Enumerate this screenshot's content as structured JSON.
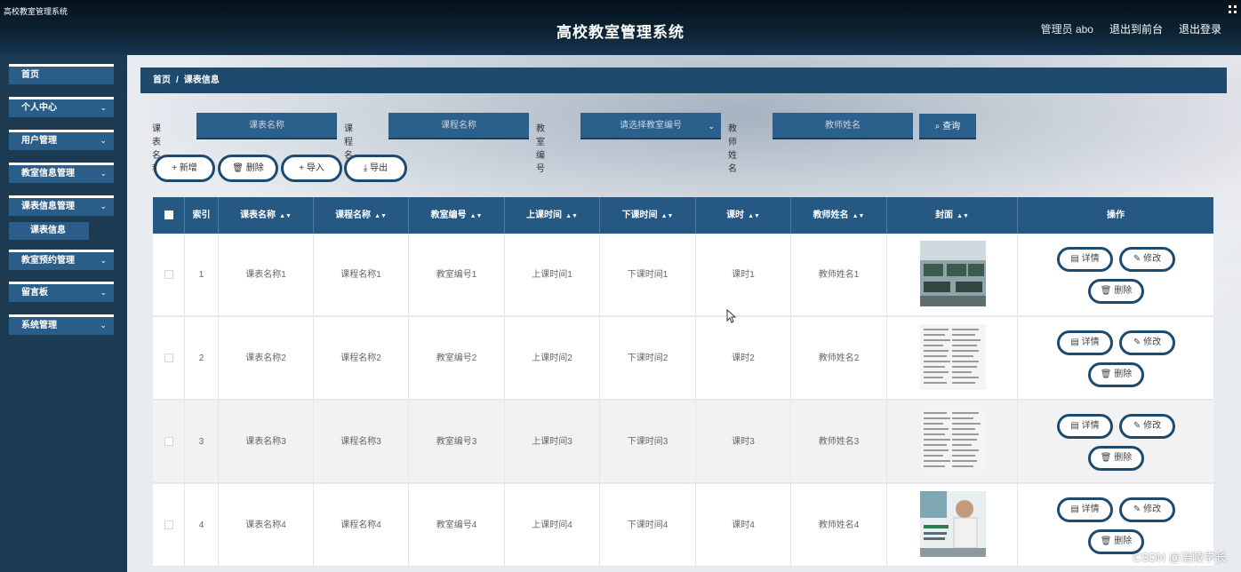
{
  "window_title": "高校教室管理系统",
  "app_title": "高校教室管理系统",
  "top_links": {
    "admin": "管理员 abo",
    "front": "退出到前台",
    "logout": "退出登录"
  },
  "sidebar": {
    "items": [
      {
        "label": "首页"
      },
      {
        "label": "个人中心"
      },
      {
        "label": "用户管理"
      },
      {
        "label": "教室信息管理"
      },
      {
        "label": "课表信息管理"
      },
      {
        "label": "教室预约管理"
      },
      {
        "label": "留言板"
      },
      {
        "label": "系统管理"
      }
    ],
    "active_sub": "课表信息"
  },
  "breadcrumb": {
    "home": "首页",
    "sep": "/",
    "current": "课表信息"
  },
  "search": {
    "f1_label": "课表名称",
    "f1_placeholder": "课表名称",
    "f2_label": "课程名称",
    "f2_placeholder": "课程名称",
    "f3_label": "教室编号",
    "f3_placeholder": "请选择教室编号",
    "f4_label": "教师姓名",
    "f4_placeholder": "教师姓名",
    "button": "查询"
  },
  "actions": {
    "add": "新增",
    "delete": "删除",
    "import": "导入",
    "export": "导出"
  },
  "table": {
    "headers": [
      "索引",
      "课表名称",
      "课程名称",
      "教室编号",
      "上课时间",
      "下课时间",
      "课时",
      "教师姓名",
      "封面",
      "操作"
    ],
    "rows": [
      {
        "index": "1",
        "schedule": "课表名称1",
        "course": "课程名称1",
        "room": "教室编号1",
        "start": "上课时间1",
        "end": "下课时间1",
        "hours": "课时1",
        "teacher": "教师姓名1"
      },
      {
        "index": "2",
        "schedule": "课表名称2",
        "course": "课程名称2",
        "room": "教室编号2",
        "start": "上课时间2",
        "end": "下课时间2",
        "hours": "课时2",
        "teacher": "教师姓名2"
      },
      {
        "index": "3",
        "schedule": "课表名称3",
        "course": "课程名称3",
        "room": "教室编号3",
        "start": "上课时间3",
        "end": "下课时间3",
        "hours": "课时3",
        "teacher": "教师姓名3"
      },
      {
        "index": "4",
        "schedule": "课表名称4",
        "course": "课程名称4",
        "room": "教室编号4",
        "start": "上课时间4",
        "end": "下课时间4",
        "hours": "课时4",
        "teacher": "教师姓名4"
      }
    ],
    "row_buttons": {
      "detail": "详情",
      "edit": "修改",
      "delete": "删除"
    }
  },
  "watermark": "CSDN @涪陵学长",
  "colors": {
    "header": "#0c2434",
    "nav": "#2a5d88",
    "table_header": "#255883",
    "button_border": "#1e4a6d"
  }
}
